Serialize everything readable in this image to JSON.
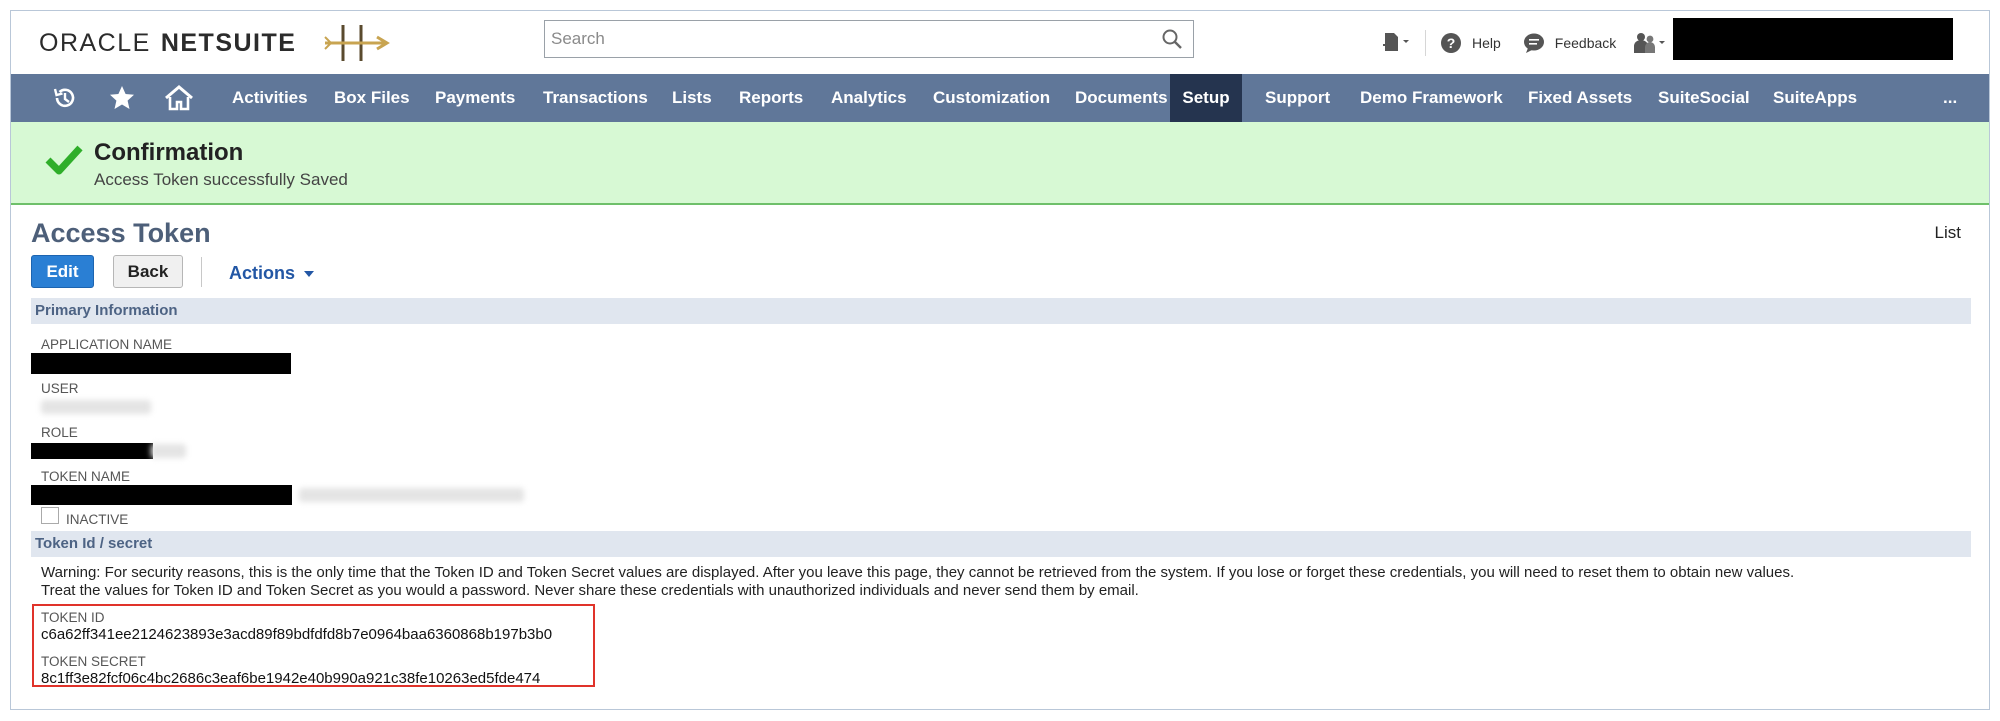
{
  "header": {
    "logo_oracle": "ORACLE",
    "logo_netsuite": "NETSUITE",
    "search_placeholder": "Search",
    "help_label": "Help",
    "feedback_label": "Feedback"
  },
  "nav": {
    "items": [
      "Activities",
      "Box Files",
      "Payments",
      "Transactions",
      "Lists",
      "Reports",
      "Analytics",
      "Customization",
      "Documents",
      "Setup",
      "Support",
      "Demo Framework",
      "Fixed Assets",
      "SuiteSocial",
      "SuiteApps"
    ],
    "active": "Setup",
    "more": "..."
  },
  "confirmation": {
    "title": "Confirmation",
    "message": "Access Token successfully Saved"
  },
  "page": {
    "title": "Access Token",
    "list_link": "List",
    "edit_label": "Edit",
    "back_label": "Back",
    "actions_label": "Actions"
  },
  "primary": {
    "section_title": "Primary Information",
    "application_name_label": "APPLICATION NAME",
    "user_label": "USER",
    "role_label": "ROLE",
    "token_name_label": "TOKEN NAME",
    "inactive_label": "INACTIVE"
  },
  "token_section": {
    "section_title": "Token Id / secret",
    "warning_line1": "Warning: For security reasons, this is the only time that the Token ID and Token Secret values are displayed. After you leave this page, they cannot be retrieved from the system. If you lose or forget these credentials, you will need to reset them to obtain new values.",
    "warning_line2": "Treat the values for Token ID and Token Secret as you would a password. Never share these credentials with unauthorized individuals and never send them by email.",
    "token_id_label": "TOKEN ID",
    "token_id_value": "c6a62ff341ee2124623893e3acd89f89bdfdfd8b7e0964baa6360868b197b3b0",
    "token_secret_label": "TOKEN SECRET",
    "token_secret_value": "8c1ff3e82fcf06c4bc2686c3eaf6be1942e40b990a921c38fe10263ed5fde474"
  },
  "colors": {
    "navbar": "#607799",
    "navbar_active": "#25344f",
    "confirm_bg": "#d7f9d4",
    "edit_button": "#2a7fd4",
    "highlight_box": "#e0332a"
  }
}
